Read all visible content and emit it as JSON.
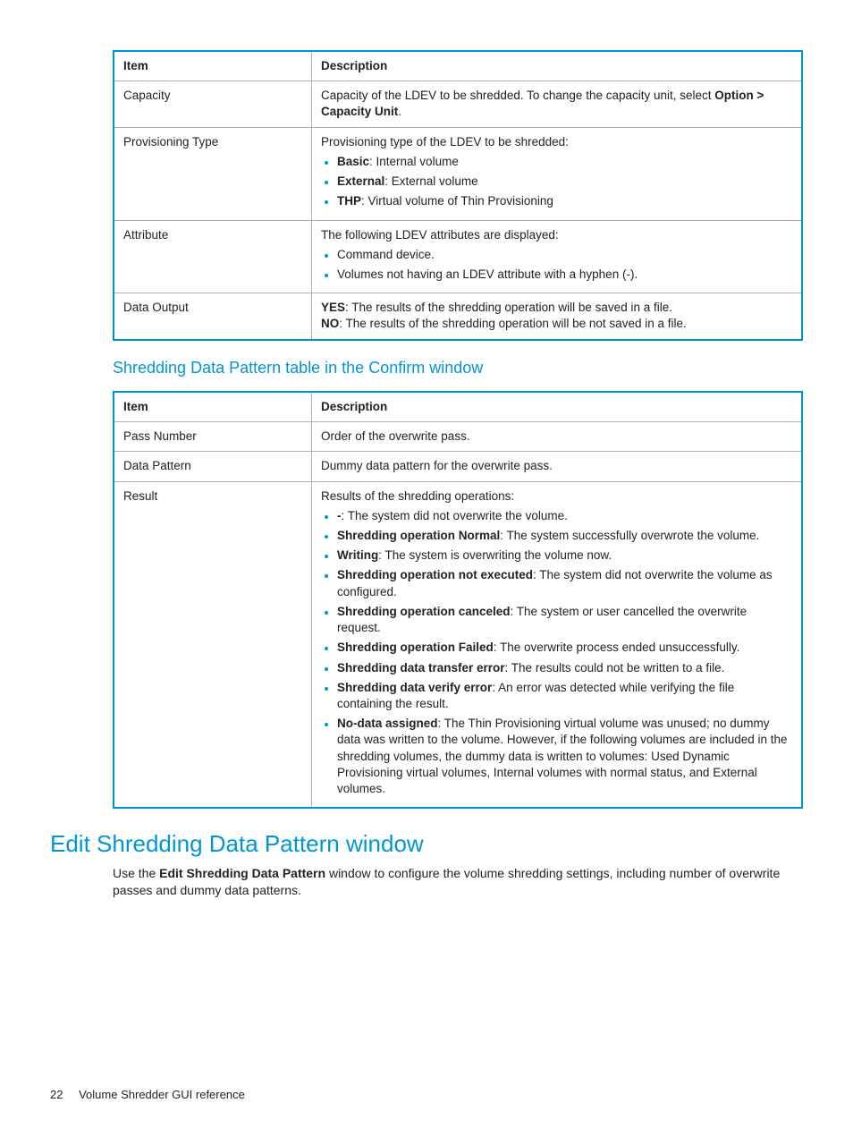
{
  "table1": {
    "headers": [
      "Item",
      "Description"
    ],
    "rows": [
      {
        "item": "Capacity",
        "desc_parts": [
          {
            "t": "text",
            "v": "Capacity of the LDEV to be shredded. To change the capacity unit, select "
          },
          {
            "t": "bold",
            "v": "Option > Capacity Unit"
          },
          {
            "t": "text",
            "v": "."
          }
        ]
      },
      {
        "item": "Provisioning Type",
        "desc_top": "Provisioning type of the LDEV to be shredded:",
        "bullets": [
          [
            {
              "t": "bold",
              "v": "Basic"
            },
            {
              "t": "text",
              "v": ": Internal volume"
            }
          ],
          [
            {
              "t": "bold",
              "v": "External"
            },
            {
              "t": "text",
              "v": ": External volume"
            }
          ],
          [
            {
              "t": "bold",
              "v": "THP"
            },
            {
              "t": "text",
              "v": ": Virtual volume of Thin Provisioning"
            }
          ]
        ]
      },
      {
        "item": "Attribute",
        "desc_top": "The following LDEV attributes are displayed:",
        "bullets": [
          [
            {
              "t": "text",
              "v": "Command device."
            }
          ],
          [
            {
              "t": "text",
              "v": "Volumes not having an LDEV attribute with a hyphen (-)."
            }
          ]
        ]
      },
      {
        "item": "Data Output",
        "lines": [
          [
            {
              "t": "bold",
              "v": "YES"
            },
            {
              "t": "text",
              "v": ": The results of the shredding operation will be saved in a file."
            }
          ],
          [
            {
              "t": "bold",
              "v": "NO"
            },
            {
              "t": "text",
              "v": ": The results of the shredding operation will be not saved in a file."
            }
          ]
        ]
      }
    ]
  },
  "subhead1": "Shredding Data Pattern table in the Confirm window",
  "table2": {
    "headers": [
      "Item",
      "Description"
    ],
    "rows": [
      {
        "item": "Pass Number",
        "plain": "Order of the overwrite pass."
      },
      {
        "item": "Data Pattern",
        "plain": "Dummy data pattern for the overwrite pass."
      },
      {
        "item": "Result",
        "desc_top": "Results of the shredding operations:",
        "bullets": [
          [
            {
              "t": "bold",
              "v": "-"
            },
            {
              "t": "text",
              "v": ": The system did not overwrite the volume."
            }
          ],
          [
            {
              "t": "bold",
              "v": "Shredding operation Normal"
            },
            {
              "t": "text",
              "v": ": The system successfully overwrote the volume."
            }
          ],
          [
            {
              "t": "bold",
              "v": "Writing"
            },
            {
              "t": "text",
              "v": ": The system is overwriting the volume now."
            }
          ],
          [
            {
              "t": "bold",
              "v": "Shredding operation not executed"
            },
            {
              "t": "text",
              "v": ": The system did not overwrite the volume as configured."
            }
          ],
          [
            {
              "t": "bold",
              "v": "Shredding operation canceled"
            },
            {
              "t": "text",
              "v": ": The system or user cancelled the overwrite request."
            }
          ],
          [
            {
              "t": "bold",
              "v": "Shredding operation Failed"
            },
            {
              "t": "text",
              "v": ": The overwrite process ended unsuccessfully."
            }
          ],
          [
            {
              "t": "bold",
              "v": "Shredding data transfer error"
            },
            {
              "t": "text",
              "v": ": The results could not be written to a file."
            }
          ],
          [
            {
              "t": "bold",
              "v": "Shredding data verify error"
            },
            {
              "t": "text",
              "v": ": An error was detected while verifying the file containing the result."
            }
          ],
          [
            {
              "t": "bold",
              "v": "No-data assigned"
            },
            {
              "t": "text",
              "v": ": The Thin Provisioning virtual volume was unused; no dummy data was written to the volume. However, if the following volumes are included in the shredding volumes, the dummy data is written to volumes: Used Dynamic Provisioning virtual volumes, Internal volumes with normal status, and External volumes."
            }
          ]
        ]
      }
    ]
  },
  "section_title": "Edit Shredding Data Pattern window",
  "section_para_parts": [
    {
      "t": "text",
      "v": "Use the "
    },
    {
      "t": "bold",
      "v": "Edit Shredding Data Pattern"
    },
    {
      "t": "text",
      "v": " window to configure the volume shredding settings, including number of overwrite passes and dummy data patterns."
    }
  ],
  "footer": {
    "page": "22",
    "title": "Volume Shredder GUI reference"
  }
}
